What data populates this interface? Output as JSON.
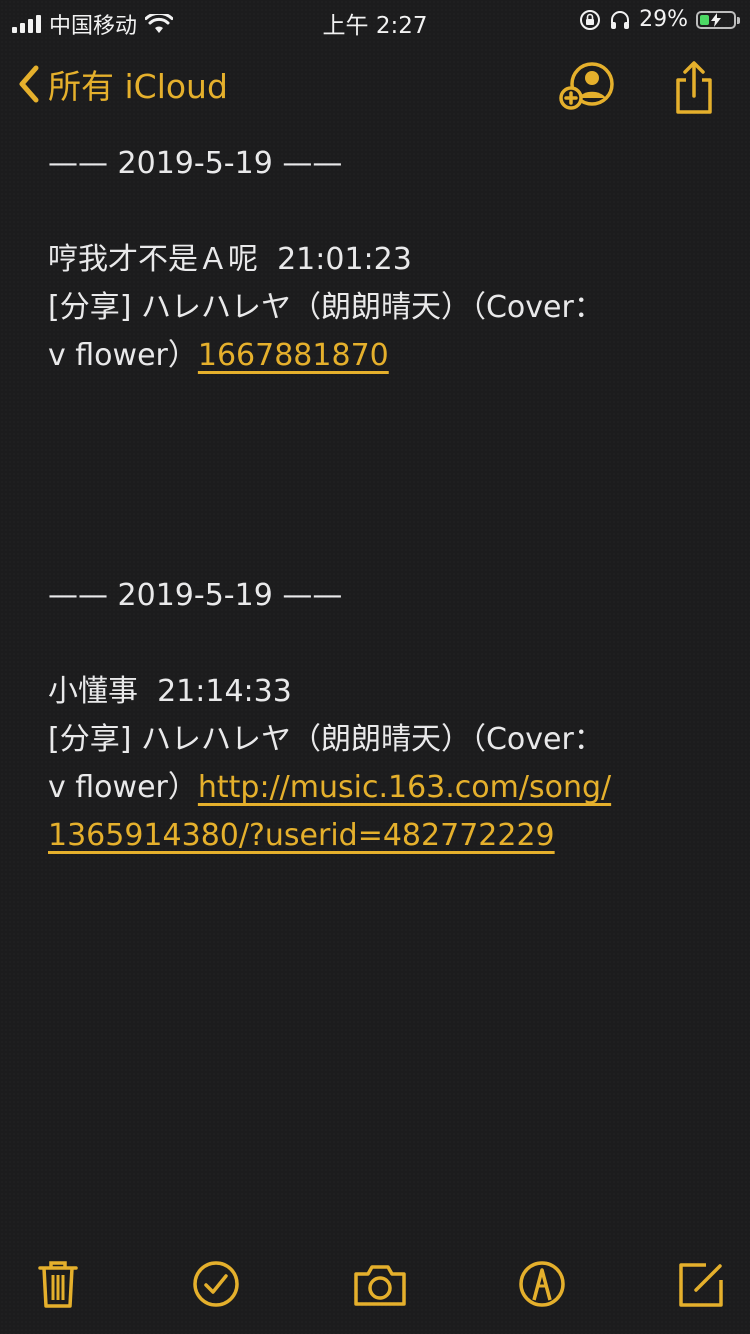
{
  "status_bar": {
    "carrier": "中国移动",
    "time": "上午 2:27",
    "battery_percent": "29%",
    "battery_level": 0.29,
    "icons": [
      "signal-icon",
      "wifi-icon",
      "orientation-lock-icon",
      "headphones-icon",
      "battery-charging-icon"
    ]
  },
  "nav": {
    "back_label": "所有 iCloud",
    "icons": [
      "chevron-left-icon",
      "add-person-icon",
      "share-icon"
    ]
  },
  "note": {
    "entry1": {
      "date_line": "—— 2019-5-19 ——",
      "author_line": "哼我才不是Ａ呢  21:01:23",
      "share_line": "[分享] ハレハレヤ（朗朗晴天）（Cover：",
      "cover_line_prefix": "v flower）",
      "link": "1667881870"
    },
    "entry2": {
      "date_line": "—— 2019-5-19 ——",
      "author_line": "小懂事  21:14:33",
      "share_line": "[分享] ハレハレヤ（朗朗晴天）（Cover：",
      "cover_line_prefix": "v flower）",
      "link_part1": "http://music.163.com/song/",
      "link_part2": "1365914380/?userid=482772229"
    }
  },
  "toolbar": {
    "icons": [
      "trash-icon",
      "checklist-icon",
      "camera-icon",
      "markup-icon",
      "compose-icon"
    ]
  },
  "colors": {
    "accent": "#e5b02c",
    "background": "#1c1c1d",
    "text": "#e9e9ea"
  }
}
